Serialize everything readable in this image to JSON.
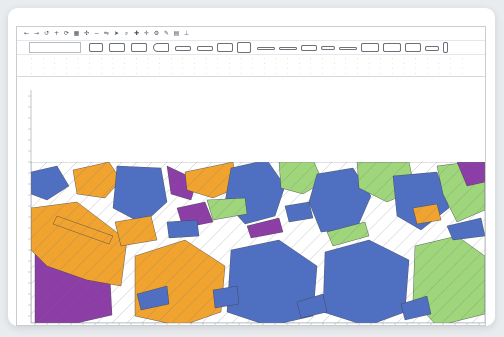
{
  "toolbar": {
    "icons": [
      {
        "name": "back-icon",
        "glyph": "←"
      },
      {
        "name": "forward-icon",
        "glyph": "→"
      },
      {
        "name": "reset-icon",
        "glyph": "↺"
      },
      {
        "name": "zoom-in-icon",
        "glyph": "+"
      },
      {
        "name": "rotate-icon",
        "glyph": "⟳"
      },
      {
        "name": "grid-icon",
        "glyph": "▦"
      },
      {
        "name": "move-icon",
        "glyph": "✣"
      },
      {
        "name": "zoom-out-icon",
        "glyph": "−"
      },
      {
        "name": "flip-icon",
        "glyph": "⇋"
      },
      {
        "name": "pointer-icon",
        "glyph": "➤"
      },
      {
        "name": "magnify-icon",
        "glyph": "⌕"
      },
      {
        "name": "plus-icon",
        "glyph": "✚"
      },
      {
        "name": "cross-icon",
        "glyph": "✛"
      },
      {
        "name": "settings-icon",
        "glyph": "⚙"
      },
      {
        "name": "pen-icon",
        "glyph": "✎"
      },
      {
        "name": "table-icon",
        "glyph": "▤"
      },
      {
        "name": "rule-icon",
        "glyph": "⊥"
      }
    ]
  },
  "colors": {
    "blue": "#4f6fc2",
    "orange": "#f0a32f",
    "green": "#9fd57b",
    "purple": "#8c3ea6",
    "grid": "#9aa0a6"
  }
}
